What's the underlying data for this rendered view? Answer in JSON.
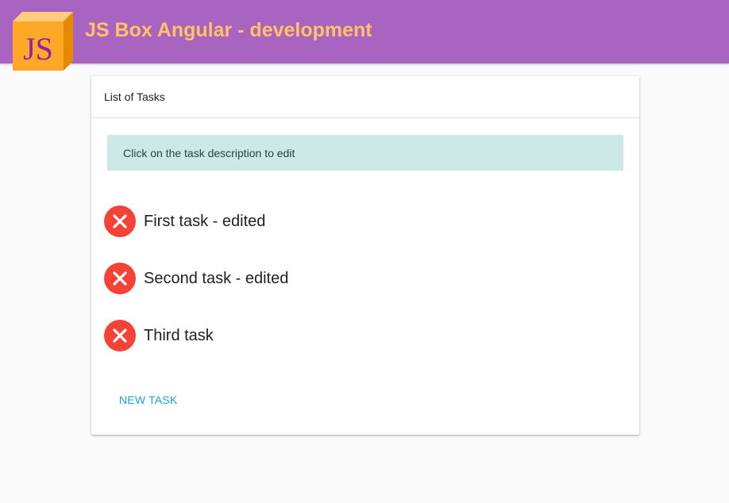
{
  "header": {
    "logo_text": "JS",
    "title": "JS Box Angular - development"
  },
  "card": {
    "title": "List of Tasks",
    "info": "Click on the task description to edit",
    "tasks": [
      {
        "label": "First task - edited"
      },
      {
        "label": "Second task - edited"
      },
      {
        "label": "Third task"
      }
    ],
    "new_task_label": "NEW TASK"
  },
  "colors": {
    "header_bg": "#a864c0",
    "title_color": "#ffc266",
    "info_bg": "#cce9e8",
    "delete_red": "#f44336",
    "link_blue": "#1aa3d9",
    "logo_orange": "#ffa726",
    "logo_text": "#8e24aa"
  },
  "icons": {
    "logo": "js-cube-logo",
    "delete": "close-icon"
  }
}
